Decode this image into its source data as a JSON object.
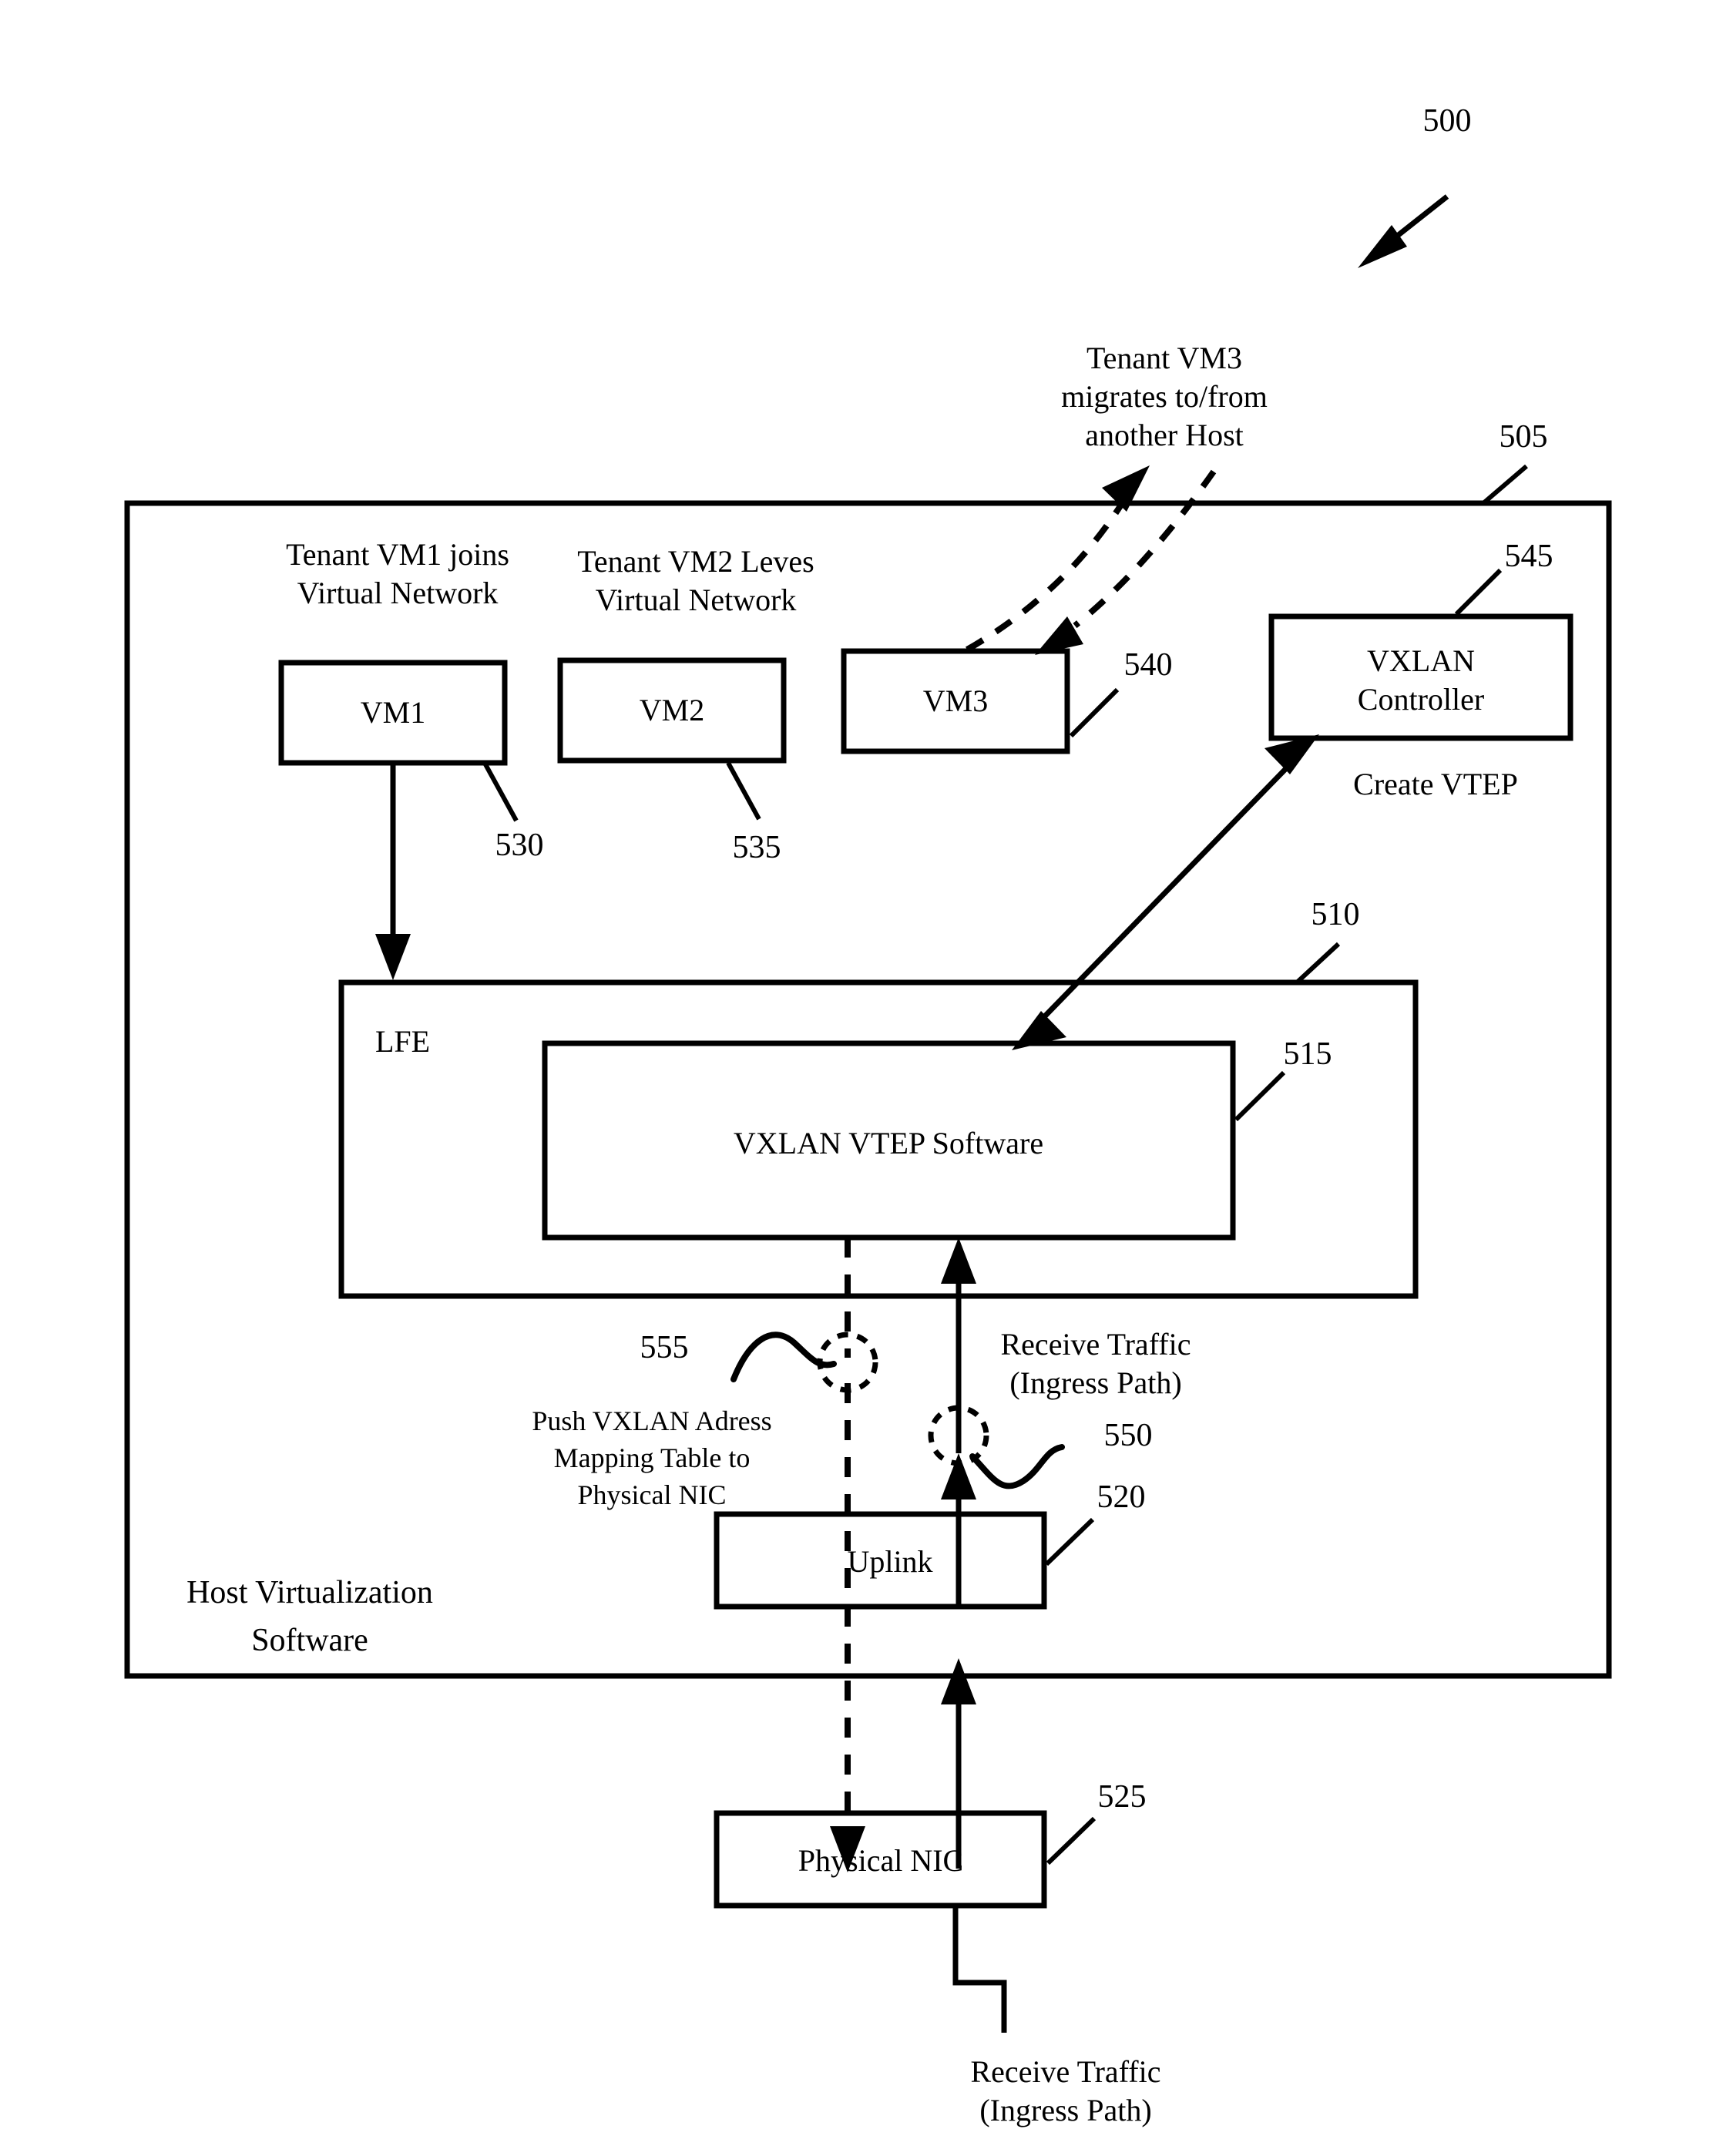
{
  "figure": {
    "number": "500",
    "host_boundary_ref": "505",
    "host_label_line1": "Host Virtualization",
    "host_label_line2": "Software"
  },
  "annotations": {
    "vm1_join_line1": "Tenant VM1 joins",
    "vm1_join_line2": "Virtual Network",
    "vm2_leave_line1": "Tenant VM2 Leves",
    "vm2_leave_line2": "Virtual Network",
    "vm3_migrate_line1": "Tenant VM3",
    "vm3_migrate_line2": "migrates to/from",
    "vm3_migrate_line3": "another Host",
    "create_vtep": "Create VTEP",
    "push_table_line1": "Push VXLAN Adress",
    "push_table_line2": "Mapping Table to",
    "push_table_line3": "Physical NIC",
    "receive_traffic_upper_line1": "Receive Traffic",
    "receive_traffic_upper_line2": "(Ingress Path)",
    "receive_traffic_lower_line1": "Receive Traffic",
    "receive_traffic_lower_line2": "(Ingress Path)"
  },
  "boxes": {
    "vm1": {
      "label": "VM1",
      "ref": "530"
    },
    "vm2": {
      "label": "VM2",
      "ref": "535"
    },
    "vm3": {
      "label": "VM3",
      "ref": "540"
    },
    "vxlan_controller": {
      "label_line1": "VXLAN",
      "label_line2": "Controller",
      "ref": "545"
    },
    "lfe": {
      "label": "LFE",
      "ref": "510"
    },
    "vtep_software": {
      "label": "VXLAN VTEP Software",
      "ref": "515"
    },
    "uplink": {
      "label": "Uplink",
      "ref": "520"
    },
    "physical_nic": {
      "label": "Physical NIC",
      "ref": "525"
    }
  },
  "callouts": {
    "push_table_ref": "555",
    "ingress_ref": "550"
  },
  "colors": {
    "stroke": "#000000",
    "background": "#ffffff"
  }
}
